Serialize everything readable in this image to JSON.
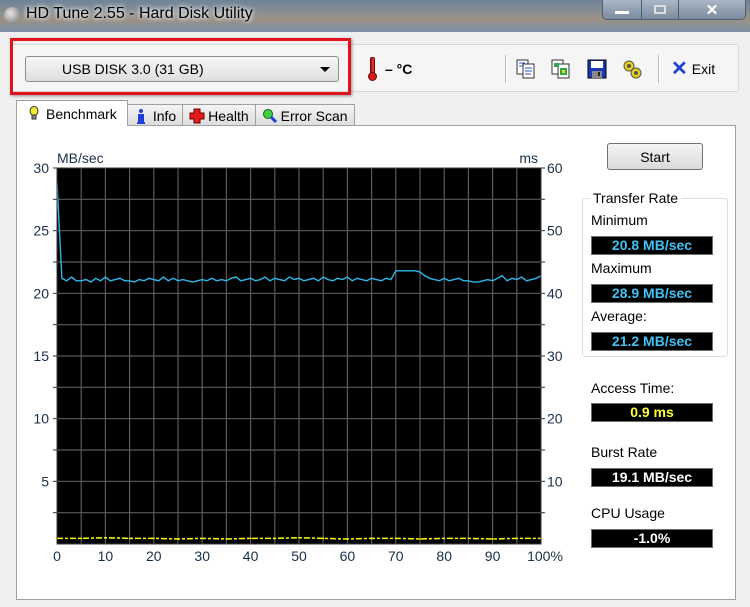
{
  "window": {
    "title": "HD Tune 2.55 - Hard Disk Utility",
    "buttons": {
      "minimize": "minimize",
      "maximize": "maximize",
      "close": "✕"
    }
  },
  "toolbar": {
    "drive": "USB DISK 3.0 (31 GB)",
    "temperature": "– °C",
    "icons": [
      "copy-text-icon",
      "copy-screenshot-icon",
      "save-icon",
      "options-icon"
    ],
    "exit_label": "Exit"
  },
  "tabs": [
    {
      "label": "Benchmark",
      "icon": "lightbulb-icon",
      "active": true
    },
    {
      "label": "Info",
      "icon": "info-icon",
      "active": false
    },
    {
      "label": "Health",
      "icon": "health-cross-icon",
      "active": false
    },
    {
      "label": "Error Scan",
      "icon": "magnifier-icon",
      "active": false
    }
  ],
  "benchmark": {
    "start_label": "Start",
    "transfer_rate": {
      "title": "Transfer Rate",
      "minimum_label": "Minimum",
      "minimum": "20.8 MB/sec",
      "maximum_label": "Maximum",
      "maximum": "28.9 MB/sec",
      "average_label": "Average:",
      "average": "21.2 MB/sec"
    },
    "access_time_label": "Access Time:",
    "access_time": "0.9 ms",
    "burst_rate_label": "Burst Rate",
    "burst_rate": "19.1 MB/sec",
    "cpu_usage_label": "CPU Usage",
    "cpu_usage": "-1.0%"
  },
  "colors": {
    "plot_bg": "#000000",
    "grid": "#5a5a5a",
    "transfer_line": "#2fb6e8",
    "access_dots": "#ffff00",
    "highlight_box": "#e0141a"
  },
  "chart_data": {
    "type": "line",
    "title": "",
    "left_axis": {
      "label": "MB/sec",
      "range": [
        0,
        30
      ],
      "ticks": [
        "30",
        "25",
        "20",
        "15",
        "10",
        "5"
      ],
      "tick_values": [
        30,
        25,
        20,
        15,
        10,
        5
      ]
    },
    "right_axis": {
      "label": "ms",
      "range": [
        0,
        60
      ],
      "ticks": [
        "60",
        "50",
        "40",
        "30",
        "20",
        "10"
      ],
      "tick_values": [
        60,
        50,
        40,
        30,
        20,
        10
      ]
    },
    "x_axis": {
      "label": "",
      "range": [
        0,
        100
      ],
      "ticks": [
        "0",
        "10",
        "20",
        "30",
        "40",
        "50",
        "60",
        "70",
        "80",
        "90",
        "100%"
      ],
      "tick_values": [
        0,
        10,
        20,
        30,
        40,
        50,
        60,
        70,
        80,
        90,
        100
      ]
    },
    "grid": true,
    "series": [
      {
        "name": "Transfer Rate",
        "axis": "left",
        "x": [
          0,
          0.5,
          1,
          2,
          3,
          4,
          5,
          6,
          7,
          8,
          9,
          10,
          11,
          12,
          13,
          14,
          15,
          16,
          17,
          18,
          19,
          20,
          21,
          22,
          23,
          24,
          25,
          26,
          27,
          28,
          29,
          30,
          31,
          32,
          33,
          34,
          35,
          36,
          37,
          38,
          39,
          40,
          41,
          42,
          43,
          44,
          45,
          46,
          47,
          48,
          49,
          50,
          51,
          52,
          53,
          54,
          55,
          56,
          57,
          58,
          59,
          60,
          61,
          62,
          63,
          64,
          65,
          66,
          67,
          68,
          69,
          70,
          71,
          72,
          73,
          74,
          75,
          76,
          77,
          78,
          79,
          80,
          81,
          82,
          83,
          84,
          85,
          86,
          87,
          88,
          89,
          90,
          91,
          92,
          93,
          94,
          95,
          96,
          97,
          98,
          99,
          100
        ],
        "values": [
          28.9,
          25.0,
          21.2,
          21.0,
          21.3,
          21.0,
          21.0,
          21.1,
          20.9,
          21.2,
          21.0,
          21.3,
          21.0,
          21.1,
          21.2,
          21.0,
          21.0,
          20.9,
          21.1,
          21.0,
          21.2,
          21.1,
          21.0,
          21.3,
          21.0,
          21.2,
          21.0,
          21.1,
          21.0,
          20.9,
          21.0,
          21.1,
          21.0,
          21.2,
          21.0,
          21.1,
          21.0,
          21.2,
          21.3,
          21.0,
          21.1,
          21.2,
          21.0,
          21.1,
          21.3,
          21.0,
          21.2,
          21.1,
          21.0,
          21.3,
          21.1,
          21.2,
          21.0,
          21.1,
          21.2,
          21.0,
          21.3,
          21.1,
          21.0,
          21.2,
          21.1,
          21.3,
          21.0,
          21.2,
          21.1,
          21.0,
          21.2,
          21.1,
          21.0,
          21.2,
          21.1,
          21.8,
          21.8,
          21.8,
          21.8,
          21.8,
          21.7,
          21.4,
          21.2,
          21.1,
          21.0,
          21.2,
          21.0,
          21.1,
          21.2,
          21.0,
          21.0,
          20.9,
          20.9,
          21.0,
          21.1,
          21.0,
          21.2,
          21.4,
          21.0,
          21.2,
          21.1,
          21.3,
          21.0,
          21.1,
          21.2,
          21.4
        ]
      },
      {
        "name": "Access Time",
        "axis": "right",
        "x": [
          0,
          5,
          10,
          15,
          20,
          25,
          30,
          35,
          40,
          45,
          50,
          55,
          60,
          65,
          70,
          75,
          80,
          85,
          90,
          95,
          100
        ],
        "values": [
          0.9,
          0.9,
          1.0,
          0.9,
          0.9,
          0.8,
          0.9,
          0.8,
          0.9,
          0.9,
          1.0,
          0.9,
          0.8,
          0.9,
          0.9,
          0.8,
          0.9,
          0.9,
          0.8,
          0.9,
          0.9
        ]
      }
    ]
  }
}
